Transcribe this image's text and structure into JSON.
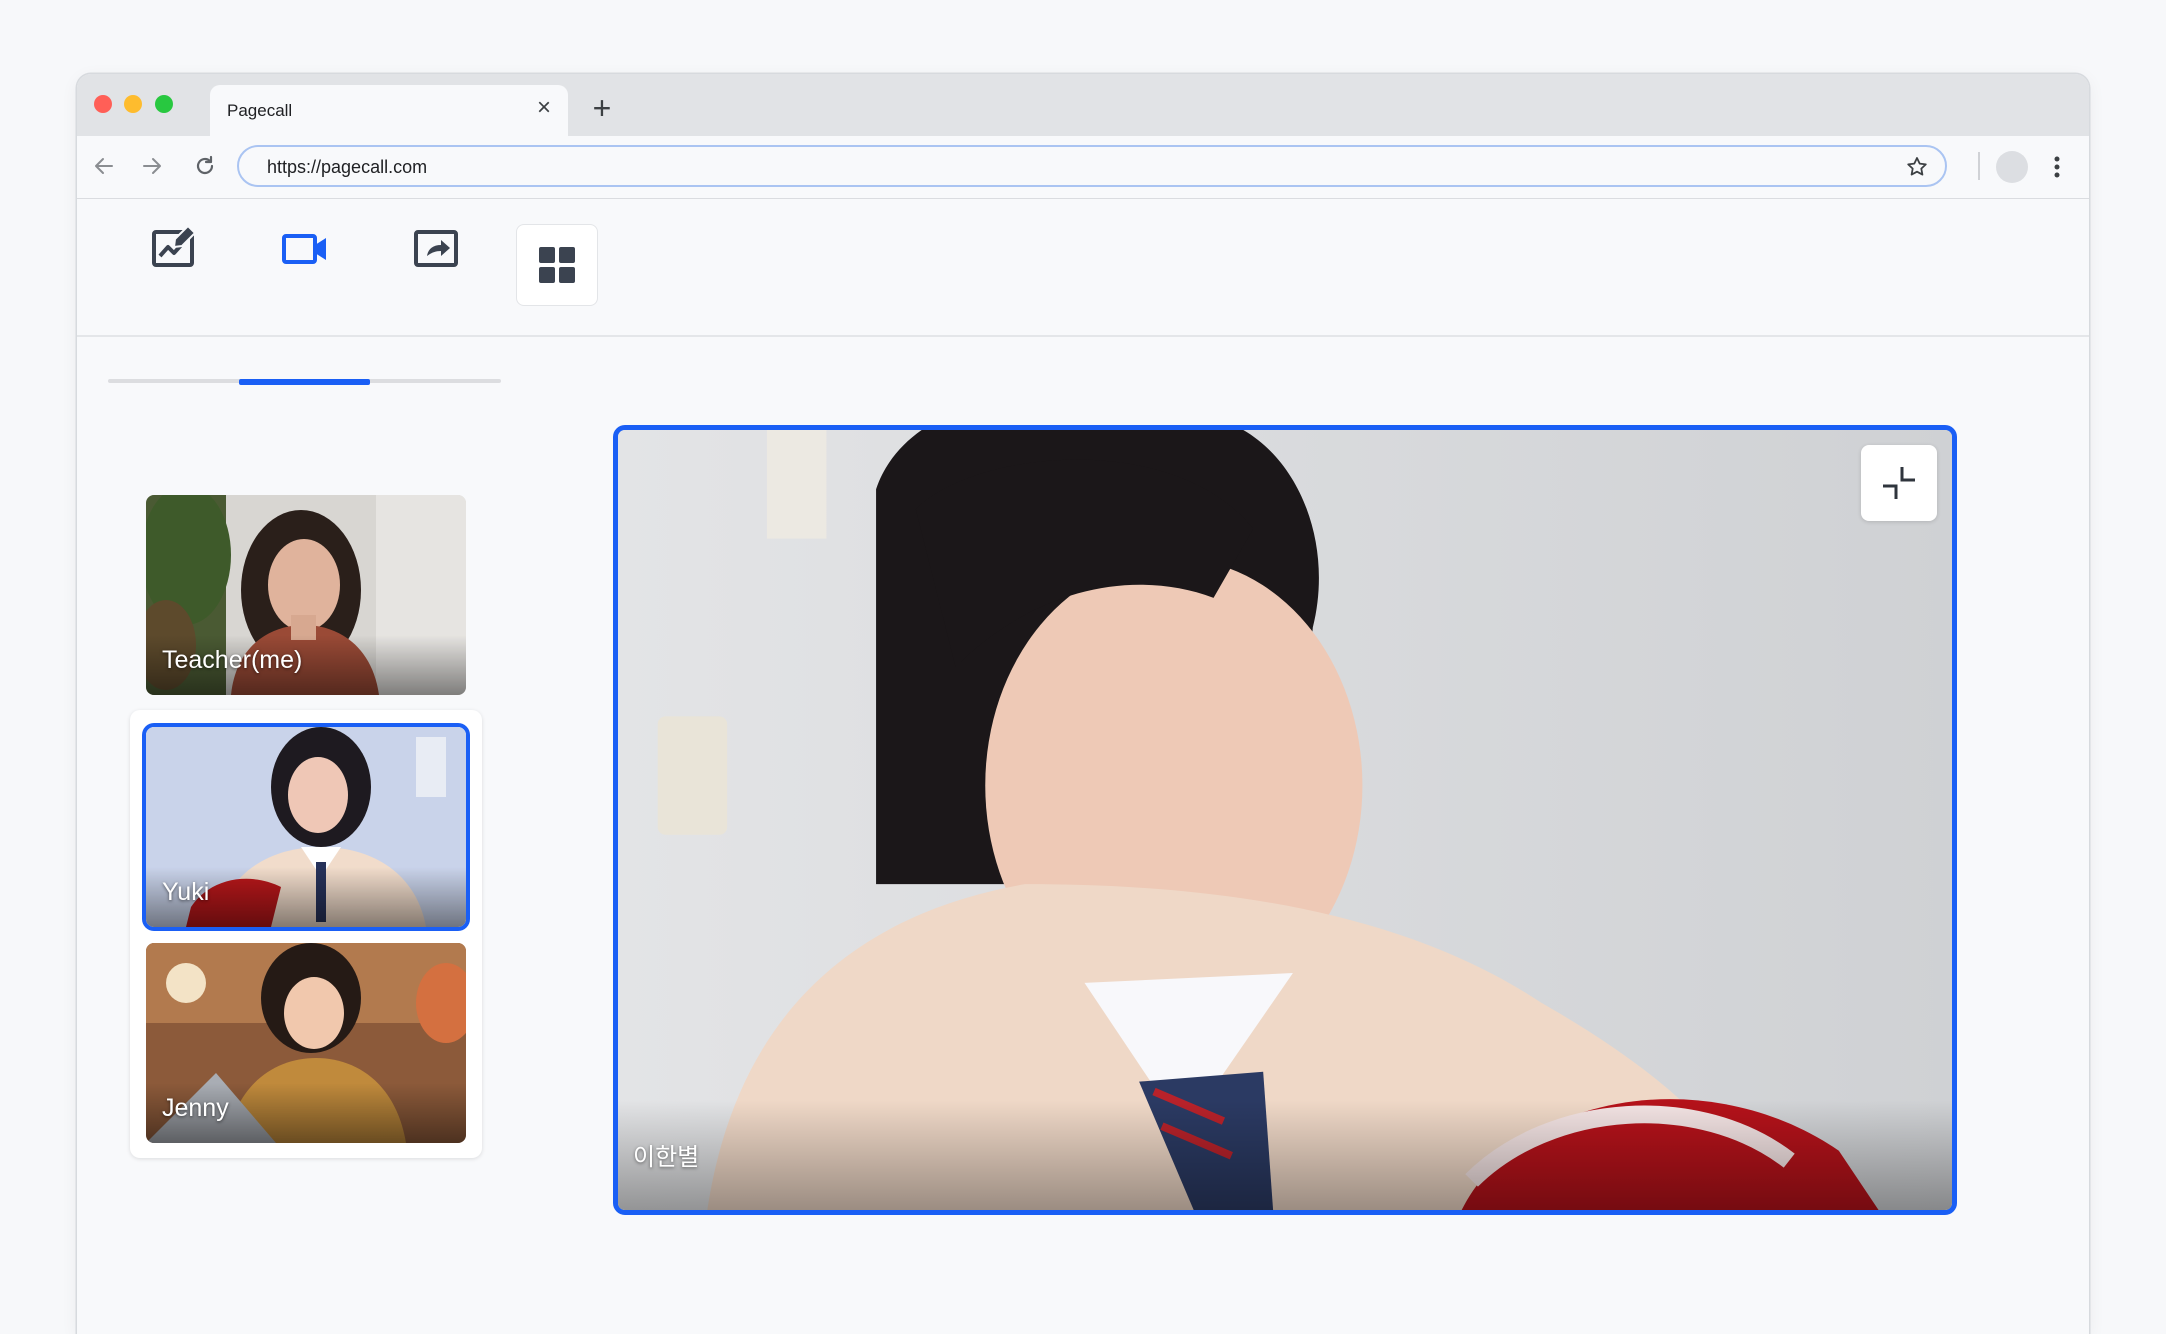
{
  "browser": {
    "tab_title": "Pagecall",
    "url": "https://pagecall.com"
  },
  "app": {
    "mode_tabs": [
      {
        "icon": "whiteboard-icon",
        "active": false
      },
      {
        "icon": "video-camera-icon",
        "active": true
      },
      {
        "icon": "screen-share-icon",
        "active": false
      }
    ],
    "grid_icon": "grid-layout-icon",
    "accent_color": "#1a5ff5"
  },
  "participants": {
    "teacher": {
      "name": "Teacher(me)"
    },
    "students": [
      {
        "name": "Yuki",
        "selected": true
      },
      {
        "name": "Jenny",
        "selected": false
      }
    ]
  },
  "main_video": {
    "name": "이한별",
    "shrink_icon": "minimize-icon"
  }
}
